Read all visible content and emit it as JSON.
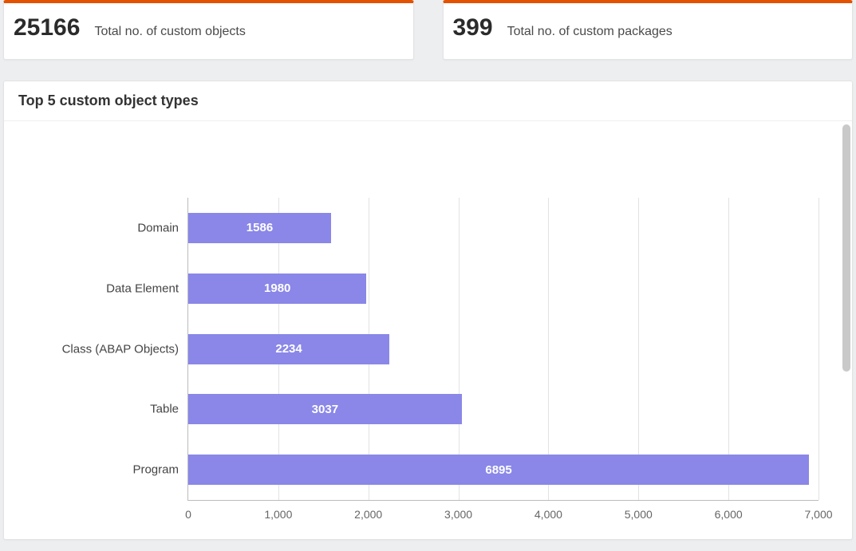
{
  "kpis": [
    {
      "value": "25166",
      "label": "Total no. of custom objects"
    },
    {
      "value": "399",
      "label": "Total no. of custom packages"
    }
  ],
  "chart_title": "Top 5 custom object types",
  "chart_data": {
    "type": "bar",
    "orientation": "horizontal",
    "categories": [
      "Domain",
      "Data Element",
      "Class (ABAP Objects)",
      "Table",
      "Program"
    ],
    "values": [
      1586,
      1980,
      2234,
      3037,
      6895
    ],
    "xlabel": "",
    "ylabel": "",
    "xlim": [
      0,
      7000
    ],
    "x_ticks": [
      0,
      1000,
      2000,
      3000,
      4000,
      5000,
      6000,
      7000
    ],
    "x_tick_labels": [
      "0",
      "1,000",
      "2,000",
      "3,000",
      "4,000",
      "5,000",
      "6,000",
      "7,000"
    ],
    "bar_color": "#8a87e8",
    "value_label_color": "#ffffff",
    "grid": true
  },
  "colors": {
    "accent": "#e35200",
    "bar": "#8a87e8"
  }
}
